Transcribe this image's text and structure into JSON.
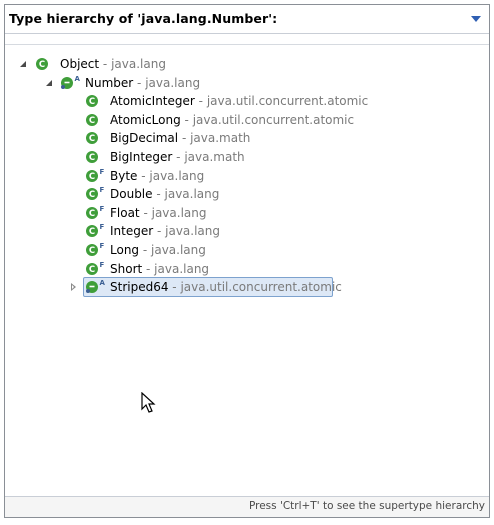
{
  "header": {
    "title": "Type hierarchy of 'java.lang.Number':"
  },
  "colors": {
    "class_icon": "#3f9e3a",
    "selection_fill": "#dde8f6",
    "selection_border": "#7da2ce"
  },
  "tree": {
    "root": {
      "name": "Object",
      "package": "java.lang",
      "icon": "class-icon"
    },
    "current": {
      "name": "Number",
      "package": "java.lang",
      "icon": "abstract-class-icon",
      "modifier": "A"
    },
    "children": [
      {
        "name": "AtomicInteger",
        "package": "java.util.concurrent.atomic",
        "icon": "class-icon",
        "modifier": ""
      },
      {
        "name": "AtomicLong",
        "package": "java.util.concurrent.atomic",
        "icon": "class-icon",
        "modifier": ""
      },
      {
        "name": "BigDecimal",
        "package": "java.math",
        "icon": "class-icon",
        "modifier": ""
      },
      {
        "name": "BigInteger",
        "package": "java.math",
        "icon": "class-icon",
        "modifier": ""
      },
      {
        "name": "Byte",
        "package": "java.lang",
        "icon": "final-class-icon",
        "modifier": "F"
      },
      {
        "name": "Double",
        "package": "java.lang",
        "icon": "final-class-icon",
        "modifier": "F"
      },
      {
        "name": "Float",
        "package": "java.lang",
        "icon": "final-class-icon",
        "modifier": "F"
      },
      {
        "name": "Integer",
        "package": "java.lang",
        "icon": "final-class-icon",
        "modifier": "F"
      },
      {
        "name": "Long",
        "package": "java.lang",
        "icon": "final-class-icon",
        "modifier": "F"
      },
      {
        "name": "Short",
        "package": "java.lang",
        "icon": "final-class-icon",
        "modifier": "F"
      },
      {
        "name": "Striped64",
        "package": "java.util.concurrent.atomic",
        "icon": "abstract-class-icon",
        "modifier": "A",
        "selected": true
      }
    ]
  },
  "footer": {
    "hint": "Press 'Ctrl+T' to see the supertype hierarchy"
  }
}
